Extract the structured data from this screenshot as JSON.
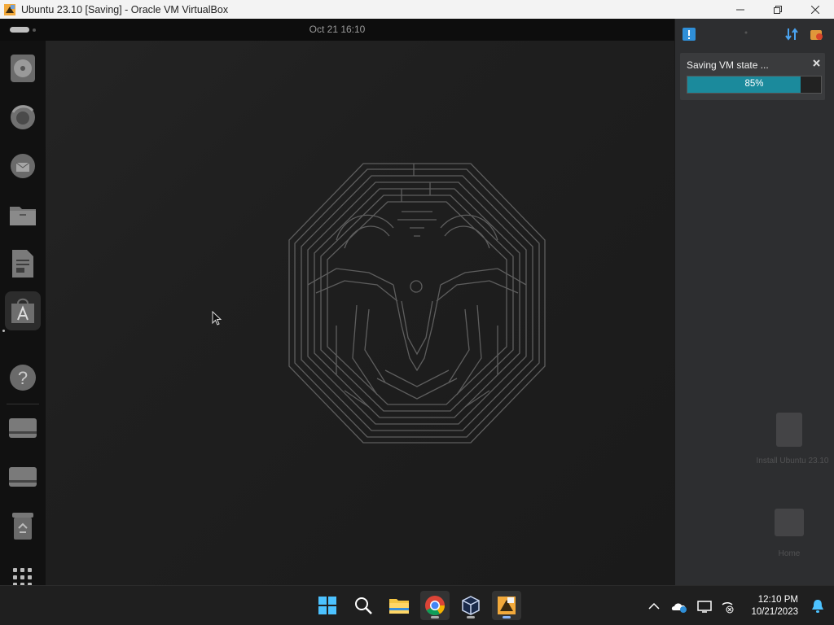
{
  "window": {
    "title": "Ubuntu 23.10 [Saving] - Oracle VM VirtualBox",
    "icons": [
      "virtualbox-app-icon",
      "minimize-icon",
      "maximize-icon",
      "close-icon"
    ]
  },
  "guest": {
    "topbar": {
      "clock": "Oct 21  16:10"
    },
    "dock": {
      "items": [
        {
          "name": "rhythmbox",
          "icon": "disc-icon"
        },
        {
          "name": "firefox",
          "icon": "firefox-icon"
        },
        {
          "name": "thunderbird",
          "icon": "thunderbird-icon"
        },
        {
          "name": "files",
          "icon": "folder-icon"
        },
        {
          "name": "writer",
          "icon": "document-icon"
        },
        {
          "name": "app-center",
          "icon": "app-store-icon"
        },
        {
          "name": "help",
          "icon": "help-icon"
        },
        {
          "name": "drive-1",
          "icon": "drive-icon"
        },
        {
          "name": "drive-2",
          "icon": "drive-icon"
        },
        {
          "name": "trash",
          "icon": "trash-icon"
        },
        {
          "name": "show-apps",
          "icon": "grid-icon"
        }
      ]
    },
    "notification": {
      "label": "Saving VM state ...",
      "progress_text": "85%",
      "progress": 0.85,
      "close_icon": "close-icon"
    },
    "ghost_labels": {
      "first": "Install Ubuntu 23.10",
      "second": "Home"
    }
  },
  "taskbar": {
    "time": "12:10 PM",
    "date": "10/21/2023",
    "apps": [
      "windows-start-icon",
      "search-icon",
      "file-explorer-icon",
      "chrome-icon",
      "virtualbox-icon",
      "virtualbox-vm-icon"
    ],
    "tray": [
      "chevron-up-icon",
      "onedrive-icon",
      "display-icon",
      "network-off-icon",
      "bell-icon"
    ]
  },
  "colors": {
    "accent": "#1b8a9c",
    "titlebar": "#f3f3f3",
    "taskbar": "#1f1f1f"
  }
}
